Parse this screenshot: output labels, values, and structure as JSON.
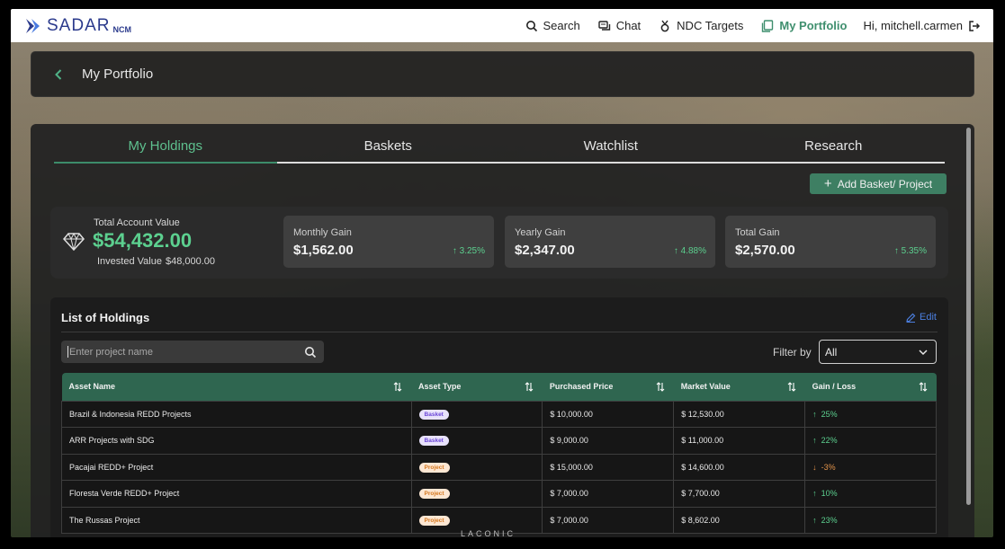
{
  "brand": {
    "name": "SADAR",
    "sub": "NCM"
  },
  "nav": {
    "search": "Search",
    "chat": "Chat",
    "ndc": "NDC Targets",
    "portfolio": "My Portfolio",
    "user": "Hi, mitchell.carmen"
  },
  "header": {
    "title": "My Portfolio"
  },
  "tabs": [
    {
      "label": "My Holdings",
      "active": true
    },
    {
      "label": "Baskets",
      "active": false
    },
    {
      "label": "Watchlist",
      "active": false
    },
    {
      "label": "Research",
      "active": false
    }
  ],
  "add_button": "Add Basket/ Project",
  "summary": {
    "total_label": "Total Account Value",
    "total_value": "$54,432.00",
    "invested_label": "Invested Value",
    "invested_value": "$48,000.00",
    "cards": [
      {
        "label": "Monthly Gain",
        "value": "$1,562.00",
        "pct": "3.25%"
      },
      {
        "label": "Yearly Gain",
        "value": "$2,347.00",
        "pct": "4.88%"
      },
      {
        "label": "Total Gain",
        "value": "$2,570.00",
        "pct": "5.35%"
      }
    ]
  },
  "holdings": {
    "title": "List of Holdings",
    "edit": "Edit",
    "search_placeholder": "Enter project name",
    "filter_label": "Filter by",
    "filter_value": "All",
    "columns": [
      "Asset Name",
      "Asset Type",
      "Purchased Price",
      "Market Value",
      "Gain / Loss"
    ],
    "rows": [
      {
        "name": "Brazil & Indonesia REDD Projects",
        "type": "Basket",
        "purchased": "$ 10,000.00",
        "market": "$ 12,530.00",
        "gain": "25%",
        "direction": "up"
      },
      {
        "name": "ARR Projects with SDG",
        "type": "Basket",
        "purchased": "$ 9,000.00",
        "market": "$ 11,000.00",
        "gain": "22%",
        "direction": "up"
      },
      {
        "name": "Pacajai REDD+ Project",
        "type": "Project",
        "purchased": "$ 15,000.00",
        "market": "$ 14,600.00",
        "gain": "-3%",
        "direction": "down"
      },
      {
        "name": "Floresta Verde REDD+ Project",
        "type": "Project",
        "purchased": "$ 7,000.00",
        "market": "$ 7,700.00",
        "gain": "10%",
        "direction": "up"
      },
      {
        "name": "The Russas Project",
        "type": "Project",
        "purchased": "$ 7,000.00",
        "market": "$ 8,602.00",
        "gain": "23%",
        "direction": "up"
      }
    ]
  },
  "footer": "LACONIC",
  "colors": {
    "accent": "#3e7f63",
    "gain": "#5cd08f",
    "loss": "#e0924a",
    "brand": "#2b3a8c"
  }
}
